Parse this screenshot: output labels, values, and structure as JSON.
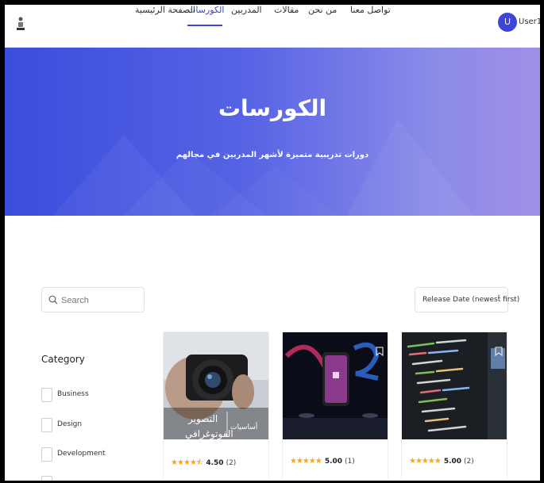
{
  "header": {
    "nav": [
      {
        "label": "تواصل معنا",
        "active": false
      },
      {
        "label": "من نحن",
        "active": false
      },
      {
        "label": "مقالات",
        "active": false
      },
      {
        "label": "المدربين",
        "active": false
      },
      {
        "label": "الكورسات",
        "active": true
      },
      {
        "label": "الصفحة الرئيسية",
        "active": false
      }
    ],
    "user": {
      "initial": "U",
      "name": "User1"
    },
    "accent": "#3b46d6"
  },
  "hero": {
    "title": "الكورسات",
    "subtitle": "دورات تدريبية متميزة لأشهر المدربين في مجالهم"
  },
  "filters": {
    "search_placeholder": "Search",
    "sort_selected": "Release Date (newest first)",
    "category_title": "Category",
    "categories": [
      "Business",
      "Design",
      "Development"
    ]
  },
  "courses": [
    {
      "image": "photography",
      "image_text_1": "التصوير",
      "image_text_2": "أساسيات",
      "image_text_3": "الفوتوغرافي",
      "rating": "4.50",
      "count": "(2)",
      "stars": 4.5
    },
    {
      "image": "phone-app",
      "rating": "5.00",
      "count": "(1)",
      "stars": 5
    },
    {
      "image": "code-screen",
      "rating": "5.00",
      "count": "(2)",
      "stars": 5
    }
  ]
}
